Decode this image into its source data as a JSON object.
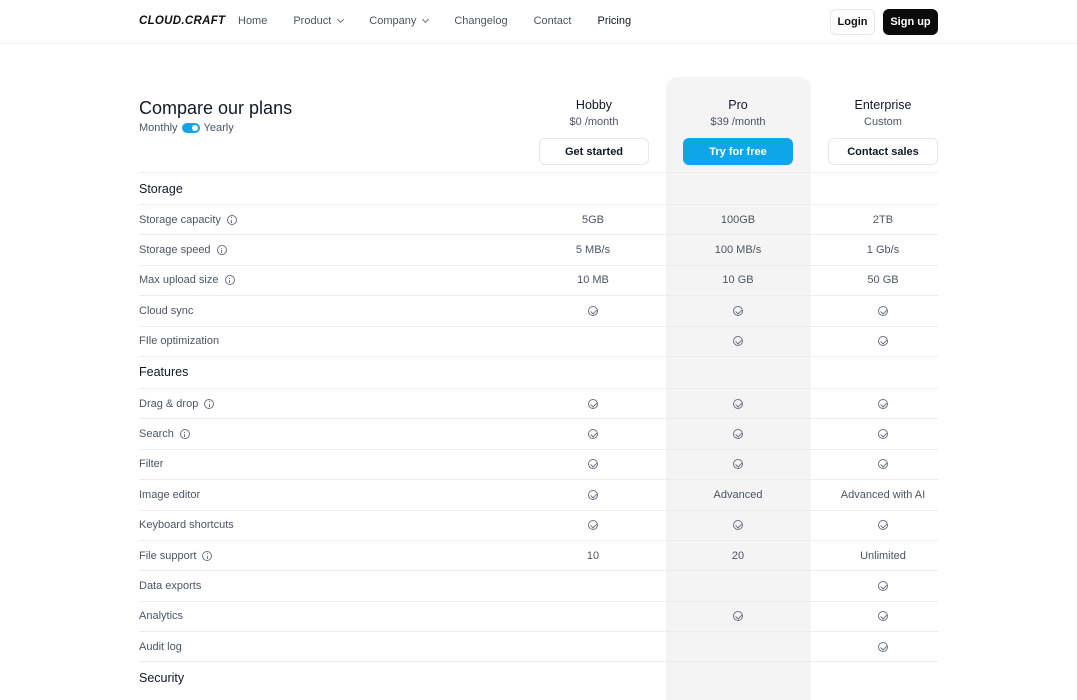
{
  "header": {
    "logo": "CLOUD.CRAFT",
    "nav": [
      {
        "label": "Home",
        "dropdown": false,
        "active": false
      },
      {
        "label": "Product",
        "dropdown": true,
        "active": false
      },
      {
        "label": "Company",
        "dropdown": true,
        "active": false
      },
      {
        "label": "Changelog",
        "dropdown": false,
        "active": false
      },
      {
        "label": "Contact",
        "dropdown": false,
        "active": false
      },
      {
        "label": "Pricing",
        "dropdown": false,
        "active": true
      }
    ],
    "login_label": "Login",
    "signup_label": "Sign up"
  },
  "compare": {
    "title": "Compare our plans",
    "monthly_label": "Monthly",
    "yearly_label": "Yearly",
    "yearly_enabled": true
  },
  "plans": [
    {
      "name": "Hobby",
      "price": "$0 /month",
      "cta": "Get started",
      "style": "outline"
    },
    {
      "name": "Pro",
      "price": "$39 /month",
      "cta": "Try for free",
      "style": "primary"
    },
    {
      "name": "Enterprise",
      "price": "Custom",
      "cta": "Contact sales",
      "style": "outline"
    }
  ],
  "colors": {
    "accent": "#0ea5e9",
    "pro_column_bg": "#f4f4f5",
    "signup_bg": "#0b0b0c"
  },
  "rows": [
    {
      "type": "section",
      "label": "Storage"
    },
    {
      "type": "feature",
      "label": "Storage capacity",
      "info": true,
      "values": [
        "5GB",
        "100GB",
        "2TB"
      ]
    },
    {
      "type": "feature",
      "label": "Storage speed",
      "info": true,
      "values": [
        "5 MB/s",
        "100 MB/s",
        "1 Gb/s"
      ]
    },
    {
      "type": "feature",
      "label": "Max upload size",
      "info": true,
      "values": [
        "10 MB",
        "10 GB",
        "50 GB"
      ]
    },
    {
      "type": "feature",
      "label": "Cloud sync",
      "info": false,
      "values": [
        "check",
        "check",
        "check"
      ]
    },
    {
      "type": "feature",
      "label": "FIle optimization",
      "info": false,
      "values": [
        "",
        "check",
        "check"
      ]
    },
    {
      "type": "section",
      "label": "Features"
    },
    {
      "type": "feature",
      "label": "Drag & drop",
      "info": true,
      "values": [
        "check",
        "check",
        "check"
      ]
    },
    {
      "type": "feature",
      "label": "Search",
      "info": true,
      "values": [
        "check",
        "check",
        "check"
      ]
    },
    {
      "type": "feature",
      "label": "Filter",
      "info": false,
      "values": [
        "check",
        "check",
        "check"
      ]
    },
    {
      "type": "feature",
      "label": "Image editor",
      "info": false,
      "values": [
        "check",
        "Advanced",
        "Advanced with AI"
      ]
    },
    {
      "type": "feature",
      "label": "Keyboard shortcuts",
      "info": false,
      "values": [
        "check",
        "check",
        "check"
      ]
    },
    {
      "type": "feature",
      "label": "File support",
      "info": true,
      "values": [
        "10",
        "20",
        "Unlimited"
      ]
    },
    {
      "type": "feature",
      "label": "Data exports",
      "info": false,
      "values": [
        "",
        "",
        "check"
      ]
    },
    {
      "type": "feature",
      "label": "Analytics",
      "info": false,
      "values": [
        "",
        "check",
        "check"
      ]
    },
    {
      "type": "feature",
      "label": "Audit log",
      "info": false,
      "values": [
        "",
        "",
        "check"
      ]
    },
    {
      "type": "section",
      "label": "Security"
    }
  ]
}
